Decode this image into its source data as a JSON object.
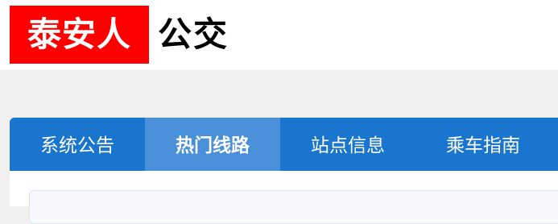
{
  "header": {
    "logo_text": "泰安人",
    "logo_suffix": "公交",
    "logo_bg_color": "#ff0000"
  },
  "tabs": [
    {
      "label": "系统公告",
      "active": false
    },
    {
      "label": "热门线路",
      "active": true
    },
    {
      "label": "站点信息",
      "active": false
    },
    {
      "label": "乘车指南",
      "active": false
    }
  ],
  "colors": {
    "tab_bar": "#1a75cf",
    "tab_active": "#4a90d9",
    "page_bg": "#f0f0f0"
  }
}
